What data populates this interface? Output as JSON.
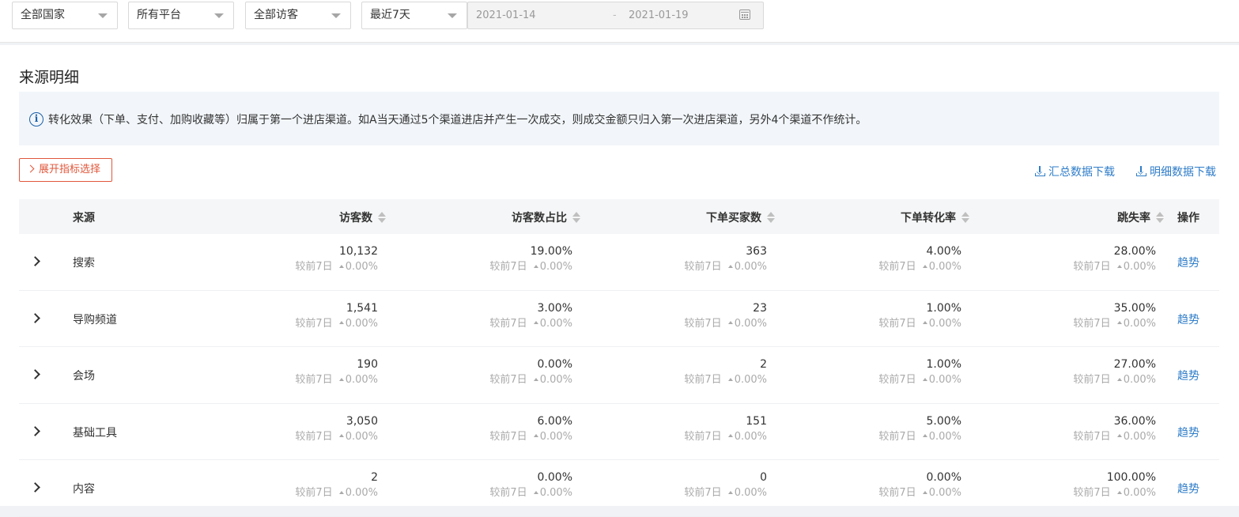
{
  "filters": {
    "country": "全部国家",
    "platform": "所有平台",
    "visitor": "全部访客",
    "period": "最近7天",
    "date_start": "2021-01-14",
    "date_sep": "-",
    "date_end": "2021-01-19"
  },
  "section_title": "来源明细",
  "info_text": "转化效果（下单、支付、加购收藏等）归属于第一个进店渠道。如A当天通过5个渠道进店并产生一次成交，则成交金额只归入第一次进店渠道，另外4个渠道不作统计。",
  "expand_label": "展开指标选择",
  "download": {
    "summary": "汇总数据下载",
    "detail": "明细数据下载"
  },
  "columns": {
    "source": "来源",
    "visitors": "访客数",
    "visitor_share": "访客数占比",
    "buyers": "下单买家数",
    "conversion": "下单转化率",
    "bounce": "跳失率",
    "action": "操作"
  },
  "compare_label": "较前7日",
  "trend_label": "趋势",
  "rows": [
    {
      "source": "搜索",
      "visitors": "10,132",
      "visitors_cmp": "0.00%",
      "visitor_share": "19.00%",
      "visitor_share_cmp": "0.00%",
      "buyers": "363",
      "buyers_cmp": "0.00%",
      "conversion": "4.00%",
      "conversion_cmp": "0.00%",
      "bounce": "28.00%",
      "bounce_cmp": "0.00%"
    },
    {
      "source": "导购频道",
      "visitors": "1,541",
      "visitors_cmp": "0.00%",
      "visitor_share": "3.00%",
      "visitor_share_cmp": "0.00%",
      "buyers": "23",
      "buyers_cmp": "0.00%",
      "conversion": "1.00%",
      "conversion_cmp": "0.00%",
      "bounce": "35.00%",
      "bounce_cmp": "0.00%"
    },
    {
      "source": "会场",
      "visitors": "190",
      "visitors_cmp": "0.00%",
      "visitor_share": "0.00%",
      "visitor_share_cmp": "0.00%",
      "buyers": "2",
      "buyers_cmp": "0.00%",
      "conversion": "1.00%",
      "conversion_cmp": "0.00%",
      "bounce": "27.00%",
      "bounce_cmp": "0.00%"
    },
    {
      "source": "基础工具",
      "visitors": "3,050",
      "visitors_cmp": "0.00%",
      "visitor_share": "6.00%",
      "visitor_share_cmp": "0.00%",
      "buyers": "151",
      "buyers_cmp": "0.00%",
      "conversion": "5.00%",
      "conversion_cmp": "0.00%",
      "bounce": "36.00%",
      "bounce_cmp": "0.00%"
    },
    {
      "source": "内容",
      "visitors": "2",
      "visitors_cmp": "0.00%",
      "visitor_share": "0.00%",
      "visitor_share_cmp": "0.00%",
      "buyers": "0",
      "buyers_cmp": "0.00%",
      "conversion": "0.00%",
      "conversion_cmp": "0.00%",
      "bounce": "100.00%",
      "bounce_cmp": "0.00%"
    }
  ]
}
